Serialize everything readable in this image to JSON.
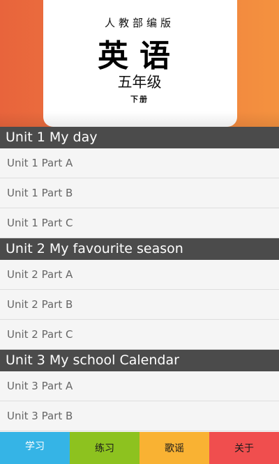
{
  "cover": {
    "publisher": "人教部编版",
    "subject": "英语",
    "grade": "五年级",
    "volume": "下册"
  },
  "units": [
    {
      "title": "Unit 1 My day",
      "lessons": [
        "Unit 1  Part A",
        "Unit 1  Part B",
        "Unit 1  Part C"
      ]
    },
    {
      "title": "Unit 2 My favourite season",
      "lessons": [
        "Unit 2  Part A",
        "Unit 2  Part B",
        "Unit 2  Part C"
      ]
    },
    {
      "title": "Unit 3 My school Calendar",
      "lessons": [
        "Unit 3  Part A",
        "Unit 3  Part B"
      ]
    }
  ],
  "tabs": [
    {
      "label": "学习",
      "color": "#35b4e6",
      "active": true
    },
    {
      "label": "练习",
      "color": "#8dc21f"
    },
    {
      "label": "歌谣",
      "color": "#f9b233"
    },
    {
      "label": "关于",
      "color": "#f04e4e"
    }
  ]
}
